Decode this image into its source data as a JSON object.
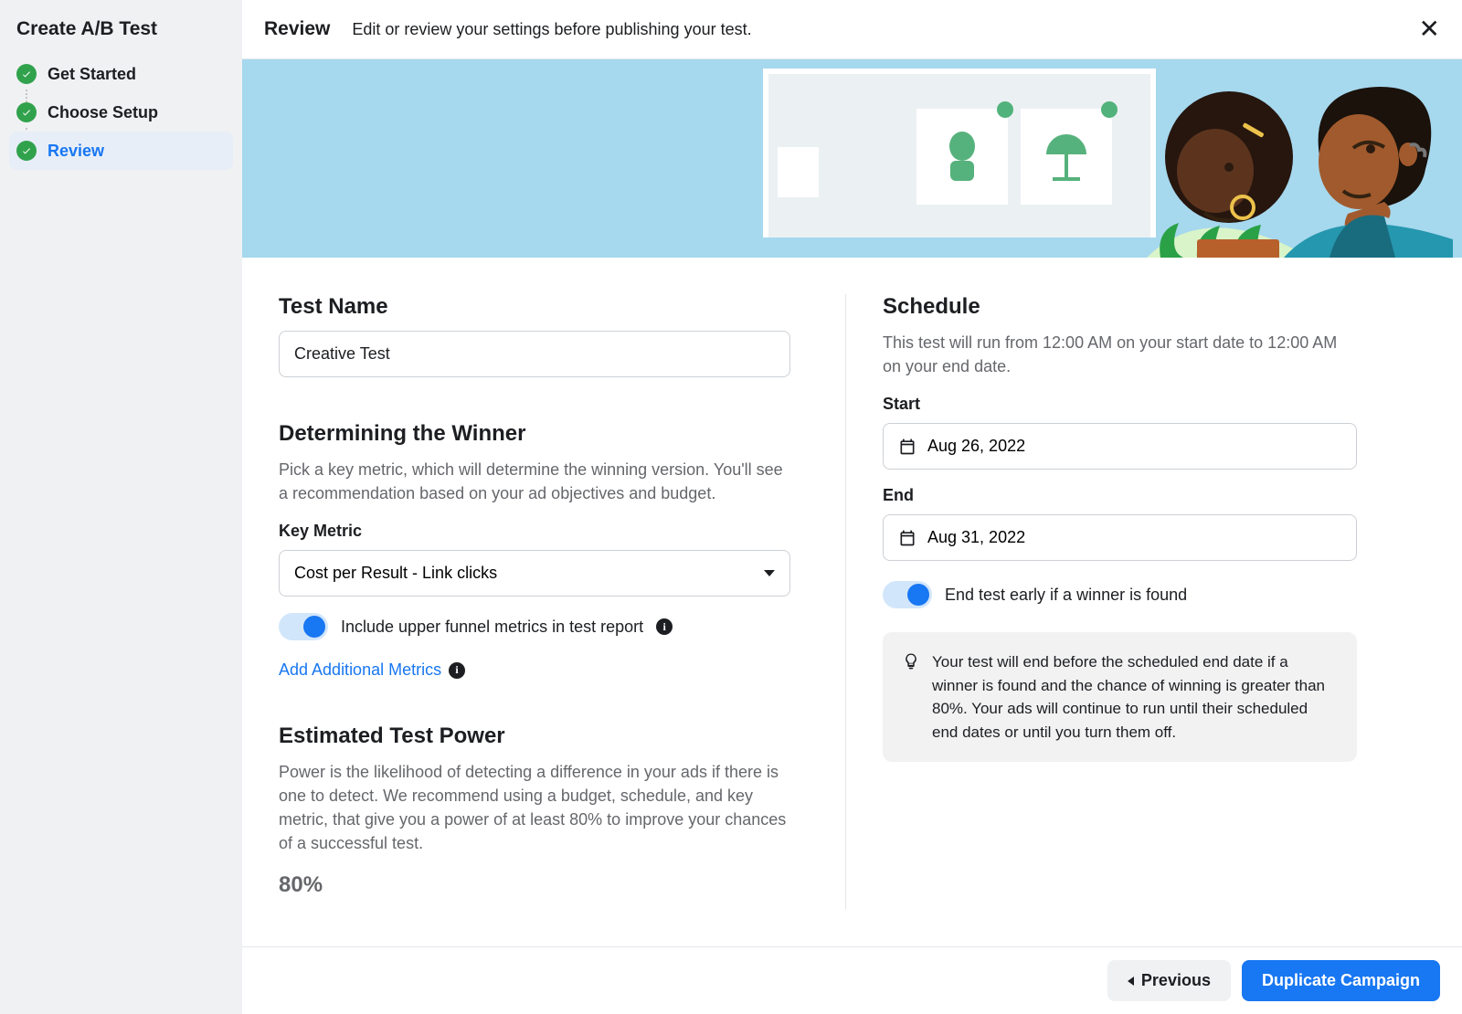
{
  "sidebar": {
    "title": "Create A/B Test",
    "steps": [
      {
        "label": "Get Started",
        "active": false
      },
      {
        "label": "Choose Setup",
        "active": false
      },
      {
        "label": "Review",
        "active": true
      }
    ]
  },
  "header": {
    "title": "Review",
    "subtitle": "Edit or review your settings before publishing your test."
  },
  "test_name": {
    "heading": "Test Name",
    "value": "Creative Test"
  },
  "winner": {
    "heading": "Determining the Winner",
    "desc": "Pick a key metric, which will determine the winning version. You'll see a recommendation based on your ad objectives and budget.",
    "metric_label": "Key Metric",
    "metric_value": "Cost per Result - Link clicks",
    "funnel_toggle_label": "Include upper funnel metrics in test report",
    "add_metrics_link": "Add Additional Metrics"
  },
  "power": {
    "heading": "Estimated Test Power",
    "desc": "Power is the likelihood of detecting a difference in your ads if there is one to detect. We recommend using a budget, schedule, and key metric, that give you a power of at least 80% to improve your chances of a successful test.",
    "value": "80%"
  },
  "schedule": {
    "heading": "Schedule",
    "desc": "This test will run from 12:00 AM on your start date to 12:00 AM on your end date.",
    "start_label": "Start",
    "start_value": "Aug 26, 2022",
    "end_label": "End",
    "end_value": "Aug 31, 2022",
    "early_end_label": "End test early if a winner is found",
    "notice": "Your test will end before the scheduled end date if a winner is found and the chance of winning is greater than 80%. Your ads will continue to run until their scheduled end dates or until you turn them off."
  },
  "footer": {
    "previous": "Previous",
    "duplicate": "Duplicate Campaign"
  }
}
